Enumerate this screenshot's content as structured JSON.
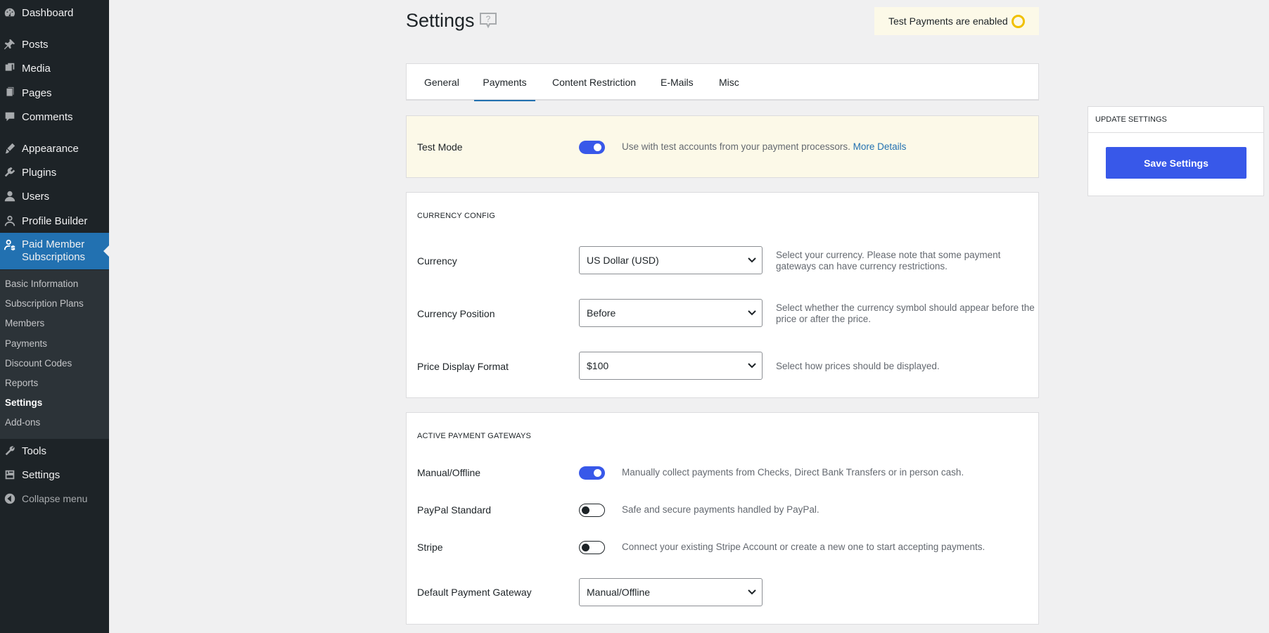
{
  "sidebar": {
    "items": [
      {
        "label": "Dashboard",
        "icon": "dashboard-icon"
      },
      {
        "label": "Posts",
        "icon": "pin-icon"
      },
      {
        "label": "Media",
        "icon": "media-icon"
      },
      {
        "label": "Pages",
        "icon": "pages-icon"
      },
      {
        "label": "Comments",
        "icon": "comment-icon"
      },
      {
        "label": "Appearance",
        "icon": "brush-icon"
      },
      {
        "label": "Plugins",
        "icon": "plugin-icon"
      },
      {
        "label": "Users",
        "icon": "users-icon"
      },
      {
        "label": "Profile Builder",
        "icon": "profile-icon"
      },
      {
        "label": "Paid Member Subscriptions",
        "icon": "member-icon"
      },
      {
        "label": "Tools",
        "icon": "wrench-icon"
      },
      {
        "label": "Settings",
        "icon": "settings-icon"
      }
    ],
    "active_line1": "Paid Member",
    "active_line2": "Subscriptions",
    "submenu": [
      "Basic Information",
      "Subscription Plans",
      "Members",
      "Payments",
      "Discount Codes",
      "Reports",
      "Settings",
      "Add-ons"
    ],
    "collapse_label": "Collapse menu"
  },
  "header": {
    "title": "Settings",
    "test_banner": "Test Payments are enabled"
  },
  "tabs": [
    "General",
    "Payments",
    "Content Restriction",
    "E-Mails",
    "Misc"
  ],
  "test_mode": {
    "label": "Test Mode",
    "enabled": true,
    "desc": "Use with test accounts from your payment processors.",
    "link": "More Details"
  },
  "currency": {
    "section_title": "CURRENCY CONFIG",
    "rows": [
      {
        "label": "Currency",
        "value": "US Dollar (USD)",
        "desc1": "Select your currency. Please note that some payment",
        "desc2": "gateways can have currency restrictions."
      },
      {
        "label": "Currency Position",
        "value": "Before",
        "desc1": "Select whether the currency symbol should appear before the",
        "desc2": "price or after the price."
      },
      {
        "label": "Price Display Format",
        "value": "$100",
        "desc1": "Select how prices should be displayed.",
        "desc2": ""
      }
    ]
  },
  "gateways": {
    "section_title": "ACTIVE PAYMENT GATEWAYS",
    "rows": [
      {
        "label": "Manual/Offline",
        "enabled": true,
        "desc": "Manually collect payments from Checks, Direct Bank Transfers or in person cash."
      },
      {
        "label": "PayPal Standard",
        "enabled": false,
        "desc": "Safe and secure payments handled by PayPal."
      },
      {
        "label": "Stripe",
        "enabled": false,
        "desc": "Connect your existing Stripe Account or create a new one to start accepting payments."
      }
    ],
    "default_label": "Default Payment Gateway",
    "default_value": "Manual/Offline"
  },
  "update": {
    "header": "UPDATE SETTINGS",
    "save_label": "Save Settings"
  },
  "colors": {
    "accent": "#3858e9",
    "sidebar_bg": "#1d2327",
    "wp_blue": "#2271b1",
    "notice_bg": "#fcf9e8"
  }
}
